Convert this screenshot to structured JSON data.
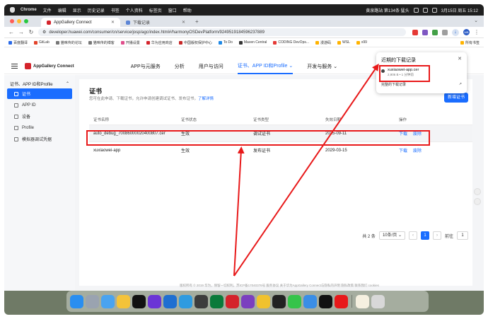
{
  "menubar": {
    "app": "Chrome",
    "items": [
      "文件",
      "编辑",
      "显示",
      "历史记录",
      "书签",
      "个人资料",
      "标签页",
      "窗口",
      "帮助"
    ],
    "status_text": "黄泉路站 第134条 猛头",
    "datetime": "3月15日 周五 15:12"
  },
  "tabs": [
    {
      "title": "AppGallery Connect",
      "active": true
    },
    {
      "title": "下载记录",
      "active": false
    }
  ],
  "address": {
    "url": "developer.huawei.com/consumer/cn/service/josp/agc/index.html#/harmonyOSDevPlatform/9249519184596237889"
  },
  "avatar_text": "MB",
  "bookmarks": [
    "百度翻译",
    "GitLab",
    "猫咪传的论坛",
    "猫咪传的博客",
    "开播设置",
    "华为应用商店",
    "中国版权保护中心",
    "To Do",
    "Maven Central",
    "CODING DevOps...",
    "漫游码",
    "WSL",
    "x99",
    "所有书签"
  ],
  "app": {
    "logo": "AppGallery Connect",
    "nav": [
      {
        "label": "APP与元服务",
        "active": false,
        "dropdown": false
      },
      {
        "label": "分析",
        "active": false,
        "dropdown": false
      },
      {
        "label": "用户与访问",
        "active": false,
        "dropdown": false
      },
      {
        "label": "证书、APP ID和Profile",
        "active": true,
        "dropdown": true
      },
      {
        "label": "开发与服务",
        "active": false,
        "dropdown": true
      }
    ]
  },
  "sidebar": {
    "group": "证书、APP ID和Profile",
    "items": [
      {
        "label": "证书",
        "active": true
      },
      {
        "label": "APP ID",
        "active": false
      },
      {
        "label": "设备",
        "active": false
      },
      {
        "label": "Profile",
        "active": false
      },
      {
        "label": "模拟器调试凭据",
        "active": false
      }
    ]
  },
  "page": {
    "title": "证书",
    "description": "您可在此申请、下载证书，允许申请创建调试证书、发布证书，",
    "description_link": "了解详情",
    "new_button": "新增证书"
  },
  "table": {
    "headers": [
      "证书名称",
      "证书状态",
      "证书类型",
      "失效日期",
      "操作"
    ],
    "rows": [
      {
        "name": "auto_debug_70086000020400807.cer",
        "status": "生效",
        "type": "调试证书",
        "expiry": "2025-09-11",
        "download": "下载",
        "delete": "废除"
      },
      {
        "name": "xuxiaowei-app",
        "status": "生效",
        "type": "发布证书",
        "expiry": "2029-03-15",
        "download": "下载",
        "delete": "废除"
      }
    ]
  },
  "pager": {
    "total": "共 2 条",
    "page_size": "10条/页",
    "current": "1",
    "goto_label": "前往",
    "goto_value": "1"
  },
  "footer": "版权所有 © 2019 华为，保留一切权利。苏ICP备17040376号    服务协议   关于华为AppGallery Connect与隐私的声明   隐私政策   联系我们   cookies",
  "downloads": {
    "title": "近期的下载记录",
    "file_name": "xuxiaowei-app.cer",
    "file_meta": "2,906 B • 1 分钟前",
    "all_link": "完整的下载记录"
  },
  "colors": {
    "accent": "#1a6dff",
    "brand": "#d4232b",
    "annotation": "#e8191a"
  }
}
